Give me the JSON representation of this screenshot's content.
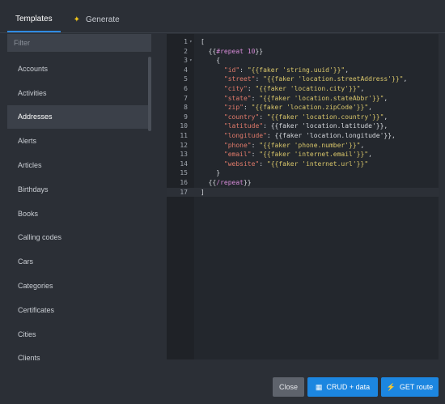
{
  "tabs": [
    {
      "label": "Templates",
      "icon": "",
      "active": true
    },
    {
      "label": "Generate",
      "icon": "sparkle-icon",
      "active": false
    }
  ],
  "filter": {
    "placeholder": "Filter",
    "value": ""
  },
  "templates": [
    "Accounts",
    "Activities",
    "Addresses",
    "Alerts",
    "Articles",
    "Birthdays",
    "Books",
    "Calling codes",
    "Cars",
    "Categories",
    "Certificates",
    "Cities",
    "Clients"
  ],
  "selected_template": "Addresses",
  "editor": {
    "lines": [
      {
        "num": "1",
        "fold": "▾",
        "tokens": [
          {
            "t": "[",
            "c": "plain"
          }
        ]
      },
      {
        "num": "2",
        "fold": "",
        "tokens": [
          {
            "t": "  {{",
            "c": "plain"
          },
          {
            "t": "#repeat",
            "c": "kw"
          },
          {
            "t": " 10",
            "c": "num"
          },
          {
            "t": "}}",
            "c": "plain"
          }
        ]
      },
      {
        "num": "3",
        "fold": "▾",
        "tokens": [
          {
            "t": "    {",
            "c": "plain"
          }
        ]
      },
      {
        "num": "4",
        "fold": "",
        "tokens": [
          {
            "t": "      ",
            "c": "plain"
          },
          {
            "t": "\"id\"",
            "c": "key"
          },
          {
            "t": ": ",
            "c": "plain"
          },
          {
            "t": "\"{{faker 'string.uuid'}}\"",
            "c": "str"
          },
          {
            "t": ",",
            "c": "plain"
          }
        ]
      },
      {
        "num": "5",
        "fold": "",
        "tokens": [
          {
            "t": "      ",
            "c": "plain"
          },
          {
            "t": "\"street\"",
            "c": "key"
          },
          {
            "t": ": ",
            "c": "plain"
          },
          {
            "t": "\"{{faker 'location.streetAddress'}}\"",
            "c": "str"
          },
          {
            "t": ",",
            "c": "plain"
          }
        ]
      },
      {
        "num": "6",
        "fold": "",
        "tokens": [
          {
            "t": "      ",
            "c": "plain"
          },
          {
            "t": "\"city\"",
            "c": "key"
          },
          {
            "t": ": ",
            "c": "plain"
          },
          {
            "t": "\"{{faker 'location.city'}}\"",
            "c": "str"
          },
          {
            "t": ",",
            "c": "plain"
          }
        ]
      },
      {
        "num": "7",
        "fold": "",
        "tokens": [
          {
            "t": "      ",
            "c": "plain"
          },
          {
            "t": "\"state\"",
            "c": "key"
          },
          {
            "t": ": ",
            "c": "plain"
          },
          {
            "t": "\"{{faker 'location.stateAbbr'}}\"",
            "c": "str"
          },
          {
            "t": ",",
            "c": "plain"
          }
        ]
      },
      {
        "num": "8",
        "fold": "",
        "tokens": [
          {
            "t": "      ",
            "c": "plain"
          },
          {
            "t": "\"zip\"",
            "c": "key"
          },
          {
            "t": ": ",
            "c": "plain"
          },
          {
            "t": "\"{{faker 'location.zipCode'}}\"",
            "c": "str"
          },
          {
            "t": ",",
            "c": "plain"
          }
        ]
      },
      {
        "num": "9",
        "fold": "",
        "tokens": [
          {
            "t": "      ",
            "c": "plain"
          },
          {
            "t": "\"country\"",
            "c": "key"
          },
          {
            "t": ": ",
            "c": "plain"
          },
          {
            "t": "\"{{faker 'location.country'}}\"",
            "c": "str"
          },
          {
            "t": ",",
            "c": "plain"
          }
        ]
      },
      {
        "num": "10",
        "fold": "",
        "tokens": [
          {
            "t": "      ",
            "c": "plain"
          },
          {
            "t": "\"latitude\"",
            "c": "key"
          },
          {
            "t": ": {{faker 'location.latitude'}},",
            "c": "plain"
          }
        ]
      },
      {
        "num": "11",
        "fold": "",
        "tokens": [
          {
            "t": "      ",
            "c": "plain"
          },
          {
            "t": "\"longitude\"",
            "c": "key"
          },
          {
            "t": ": {{faker 'location.longitude'}},",
            "c": "plain"
          }
        ]
      },
      {
        "num": "12",
        "fold": "",
        "tokens": [
          {
            "t": "      ",
            "c": "plain"
          },
          {
            "t": "\"phone\"",
            "c": "key"
          },
          {
            "t": ": ",
            "c": "plain"
          },
          {
            "t": "\"{{faker 'phone.number'}}\"",
            "c": "str"
          },
          {
            "t": ",",
            "c": "plain"
          }
        ]
      },
      {
        "num": "13",
        "fold": "",
        "tokens": [
          {
            "t": "      ",
            "c": "plain"
          },
          {
            "t": "\"email\"",
            "c": "key"
          },
          {
            "t": ": ",
            "c": "plain"
          },
          {
            "t": "\"{{faker 'internet.email'}}\"",
            "c": "str"
          },
          {
            "t": ",",
            "c": "plain"
          }
        ]
      },
      {
        "num": "14",
        "fold": "",
        "tokens": [
          {
            "t": "      ",
            "c": "plain"
          },
          {
            "t": "\"website\"",
            "c": "key"
          },
          {
            "t": ": ",
            "c": "plain"
          },
          {
            "t": "\"{{faker 'internet.url'}}\"",
            "c": "str"
          }
        ]
      },
      {
        "num": "15",
        "fold": "",
        "tokens": [
          {
            "t": "    }",
            "c": "plain"
          }
        ]
      },
      {
        "num": "16",
        "fold": "",
        "tokens": [
          {
            "t": "  {{",
            "c": "plain"
          },
          {
            "t": "/repeat",
            "c": "kw"
          },
          {
            "t": "}}",
            "c": "plain"
          }
        ]
      },
      {
        "num": "17",
        "fold": "",
        "tokens": [
          {
            "t": "]",
            "c": "plain"
          }
        ]
      }
    ],
    "active_line": "17"
  },
  "footer": {
    "close_label": "Close",
    "crud_label": "CRUD + data",
    "crud_icon": "crud-icon",
    "get_label": "GET route",
    "get_icon": "bolt-icon"
  },
  "colors": {
    "accent": "#1c86e0",
    "background": "#2b2f36",
    "editor_bg": "#23272d",
    "json_key": "#e07a6a",
    "json_string": "#d9c66a",
    "template_keyword": "#d68bd8"
  }
}
